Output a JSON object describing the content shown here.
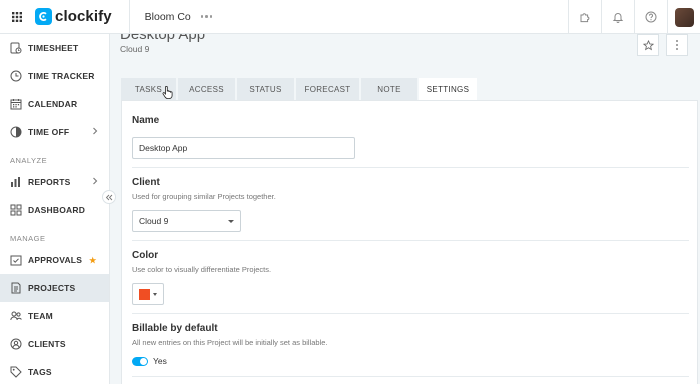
{
  "topbar": {
    "brand": "clockify",
    "workspace": "Bloom Co",
    "icons": [
      "apps-grid-icon",
      "more-horizontal-icon",
      "puzzle-icon",
      "bell-icon",
      "help-icon",
      "avatar"
    ]
  },
  "sidebar": {
    "items_top": [
      {
        "label": "TIMESHEET",
        "icon": "timesheet-icon"
      },
      {
        "label": "TIME TRACKER",
        "icon": "clock-icon"
      },
      {
        "label": "CALENDAR",
        "icon": "calendar-icon"
      },
      {
        "label": "TIME OFF",
        "icon": "time-off-icon",
        "chevron": true
      }
    ],
    "section_analyze": "ANALYZE",
    "items_analyze": [
      {
        "label": "REPORTS",
        "icon": "bar-chart-icon",
        "chevron": true
      },
      {
        "label": "DASHBOARD",
        "icon": "dashboard-icon"
      }
    ],
    "section_manage": "MANAGE",
    "items_manage": [
      {
        "label": "APPROVALS",
        "icon": "approvals-icon",
        "badge": "★"
      },
      {
        "label": "PROJECTS",
        "icon": "document-icon",
        "active": true
      },
      {
        "label": "TEAM",
        "icon": "team-icon"
      },
      {
        "label": "CLIENTS",
        "icon": "clients-icon"
      },
      {
        "label": "TAGS",
        "icon": "tag-icon"
      }
    ]
  },
  "project": {
    "title": "Desktop App",
    "client": "Cloud 9"
  },
  "tabs": [
    {
      "label": "TASKS"
    },
    {
      "label": "ACCESS"
    },
    {
      "label": "STATUS"
    },
    {
      "label": "FORECAST"
    },
    {
      "label": "NOTE"
    },
    {
      "label": "SETTINGS",
      "active": true
    }
  ],
  "settings": {
    "name_title": "Name",
    "name_value": "Desktop App",
    "client_title": "Client",
    "client_desc": "Used for grouping similar Projects together.",
    "client_value": "Cloud 9",
    "color_title": "Color",
    "color_desc": "Use color to visually differentiate Projects.",
    "color_value": "#f04e23",
    "billable_title": "Billable by default",
    "billable_desc": "All new entries on this Project will be initially set as billable.",
    "billable_toggle": "Yes"
  },
  "colors": {
    "accent": "#03a9f4",
    "active_nav": "#e4eaee",
    "badge": "#f39c12"
  }
}
